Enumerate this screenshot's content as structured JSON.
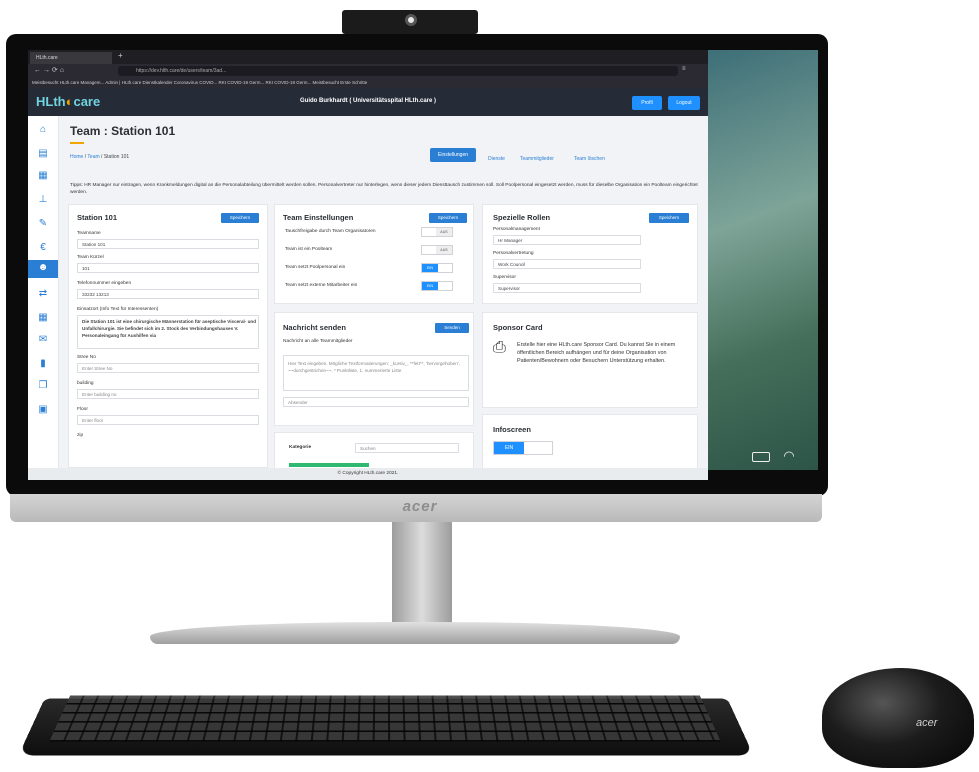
{
  "hardware": {
    "monitor_brand": "acer",
    "mouse_brand": "acer"
  },
  "browser": {
    "tab_title": "HLth.care",
    "url": "https://dev.hlth.care/de/users/team/3ad...",
    "bookmarks": "Meistbesucht   HLth.care Managem...   Admin | HLth.care   Dienstkalender   Coronavirus COVID...   RKI COVID-19 Germ...   RKI COVID-19 Germ...   Meistbesucht   Erste Schritte"
  },
  "app": {
    "logo_prefix": "HLth",
    "logo_suffix": "care",
    "user": "Guido Burkhardt ( Universitätsspital HLth.care )",
    "profil": "Profil",
    "logout": "Logout"
  },
  "page": {
    "title": "Team : Station 101",
    "breadcrumb_home": "Home",
    "breadcrumb_team": "Team",
    "breadcrumb_current": "Station 101",
    "tabs": [
      "Einstellungen",
      "Dienste",
      "Teammitglieder",
      "Team löschen"
    ],
    "tipp": "Tipps: HR Manager nur eintragen, wenn Krankmeldungen digital an die Personalabteilung übermittelt werden sollen. Personalvertreter nur hinterlegen, wenn dieser jedem Diensttausch zustimmen soll. Soll Poolpersonal eingesetzt werden, muss für dieselbe Organisation ein Poolteam eingerichtet werden."
  },
  "station": {
    "title": "Station 101",
    "save": "Speichern",
    "teamname_label": "Teamname",
    "teamname": "Station 101",
    "kuerzel_label": "Team Kürzel",
    "kuerzel": "101",
    "telefon_label": "Telefonnummer eingeben",
    "telefon": "33232 13213",
    "einsatzort_label": "Einsatzort (Info Text für Interessenten)",
    "einsatzort": "Die Station 101 ist eine chirurgische Männerstation für aseptische Visceral- und Unfallchirurgie. Sie befindet sich im 2. Stock des Verbindungshauses V. Personaleingang für Aushilfen via",
    "street_label": "Stree No",
    "street_ph": "Enter Stree No",
    "building_label": "building",
    "building_ph": "Enter building no",
    "floor_label": "Floor",
    "floor_ph": "Enter floor",
    "zip_label": "zip"
  },
  "team_settings": {
    "title": "Team Einstellungen",
    "save": "Speichern",
    "rows": [
      {
        "label": "Tauschfreigabe durch Team Organisatoren",
        "state": "AUS"
      },
      {
        "label": "Team ist ein Poolteam",
        "state": "AUS"
      },
      {
        "label": "Team setzt Poolpersonal ein",
        "state": "EIN"
      },
      {
        "label": "Team setzt externe Mitarbeiter ein",
        "state": "EIN"
      }
    ]
  },
  "roles": {
    "title": "Spezielle Rollen",
    "save": "Speichern",
    "personal_label": "Personalmanagement",
    "personal": "Hr Manager",
    "vertretung_label": "Personalvertretung",
    "vertretung": "Work Council",
    "supervisor_label": "Supervisor",
    "supervisor": "Supervisor"
  },
  "message": {
    "title": "Nachricht senden",
    "send": "Senden",
    "subtitle": "Nachricht an alle Teammitglieder",
    "text_ph": "Hier Text eingeben. Mögliche Textformatierungen: _kursiv_, **fett**, 'hervorgehoben', ~~durchgestrichen~~, * Punktliste, 1. nummerierte Liste",
    "absender_ph": "Absender"
  },
  "sponsor": {
    "title": "Sponsor Card",
    "text": "Erstelle hier eine HLth.care Sponsor Card. Du kannst Sie in einem öffentlichen Bereich aufhängen und für deine Organisation von Patienten/Bewohnern oder Besuchern Unterstützung erhalten."
  },
  "category": {
    "label": "Kategorie",
    "search_ph": "Suchen"
  },
  "infoscreen": {
    "title": "Infoscreen",
    "state": "EIN"
  },
  "footer": "© Copyright HLth.care 2021.",
  "sidebar_icons": [
    "home-icon",
    "calendar-icon",
    "grid-icon",
    "org-chart-icon",
    "document-icon",
    "euro-icon",
    "team-icon",
    "swap-icon",
    "calendar-small-icon",
    "mail-icon",
    "file-icon",
    "copy-icon",
    "schedule-icon"
  ]
}
